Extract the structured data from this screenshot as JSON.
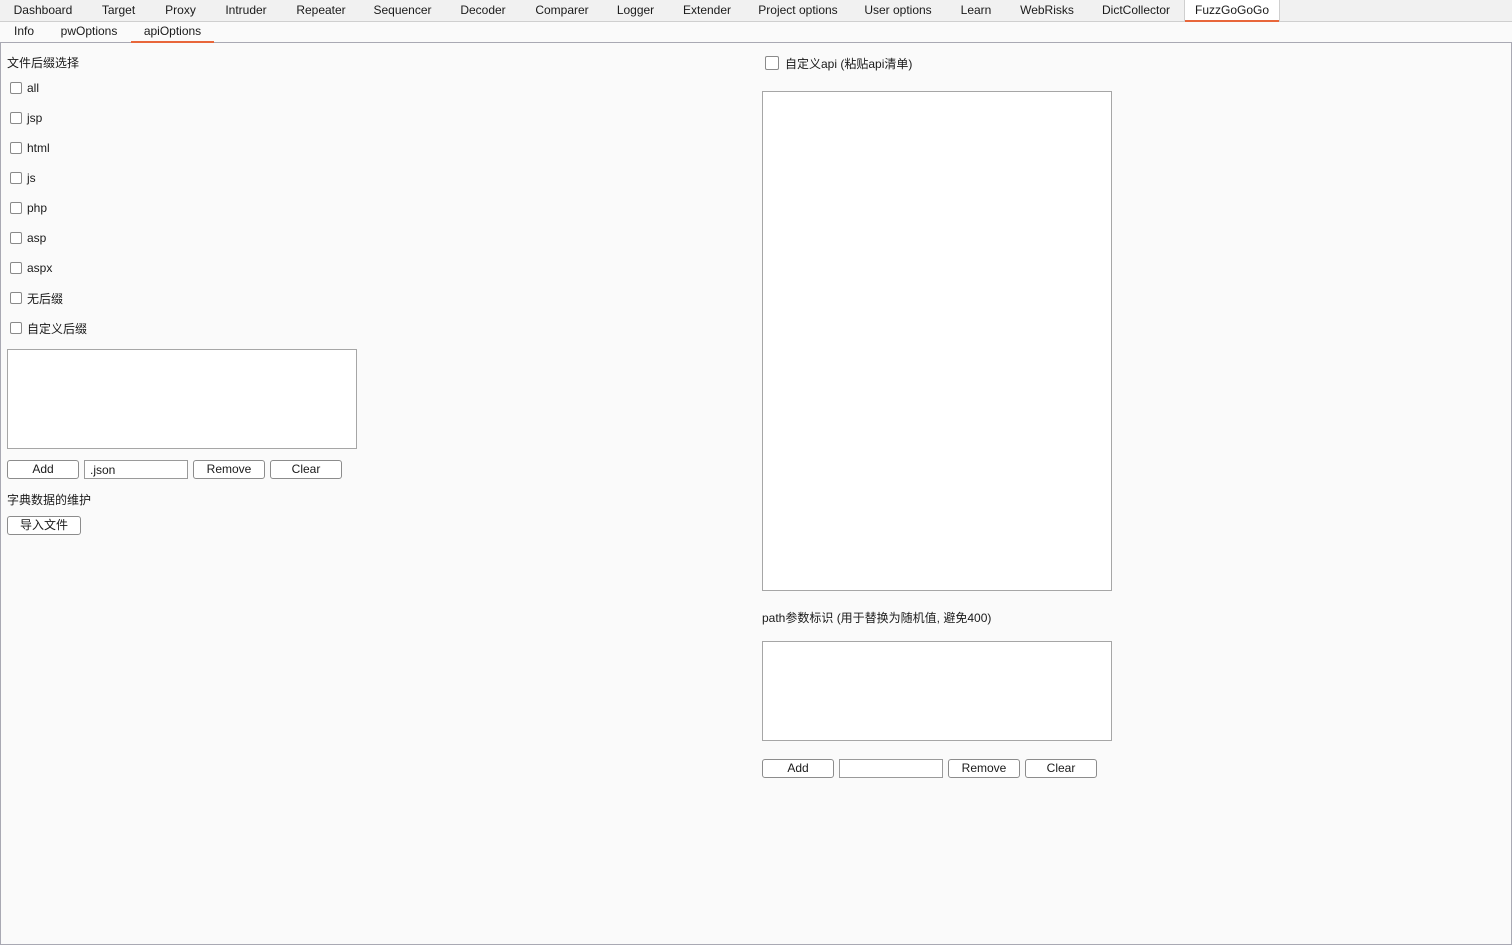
{
  "top_tabs": [
    {
      "label": "Dashboard"
    },
    {
      "label": "Target"
    },
    {
      "label": "Proxy"
    },
    {
      "label": "Intruder"
    },
    {
      "label": "Repeater"
    },
    {
      "label": "Sequencer"
    },
    {
      "label": "Decoder"
    },
    {
      "label": "Comparer"
    },
    {
      "label": "Logger"
    },
    {
      "label": "Extender"
    },
    {
      "label": "Project options"
    },
    {
      "label": "User options"
    },
    {
      "label": "Learn"
    },
    {
      "label": "WebRisks"
    },
    {
      "label": "DictCollector"
    },
    {
      "label": "FuzzGoGoGo"
    }
  ],
  "active_top_tab": "FuzzGoGoGo",
  "sub_tabs": [
    {
      "label": "Info"
    },
    {
      "label": "pwOptions"
    },
    {
      "label": "apiOptions"
    }
  ],
  "active_sub_tab": "apiOptions",
  "left": {
    "suffix_title": "文件后缀选择",
    "suffix_options": [
      {
        "label": "all",
        "checked": false
      },
      {
        "label": "jsp",
        "checked": false
      },
      {
        "label": "html",
        "checked": false
      },
      {
        "label": "js",
        "checked": false
      },
      {
        "label": "php",
        "checked": false
      },
      {
        "label": "asp",
        "checked": false
      },
      {
        "label": "aspx",
        "checked": false
      },
      {
        "label": "无后缀",
        "checked": false
      },
      {
        "label": "自定义后缀",
        "checked": false
      }
    ],
    "custom_suffix_text": "",
    "add_label": "Add",
    "suffix_input_value": ".json",
    "remove_label": "Remove",
    "clear_label": "Clear",
    "dict_title": "字典数据的维护",
    "import_label": "导入文件"
  },
  "right": {
    "custom_api_label": "自定义api (粘贴api清单)",
    "custom_api_checked": false,
    "api_list_text": "",
    "path_param_title": "path参数标识 (用于替换为随机值, 避免400)",
    "path_param_text": "",
    "add_label": "Add",
    "param_input_value": "",
    "remove_label": "Remove",
    "clear_label": "Clear"
  },
  "colors": {
    "accent": "#e8663a",
    "panel_bg": "#fafafa",
    "tabbar_bg": "#f1f1f1"
  }
}
